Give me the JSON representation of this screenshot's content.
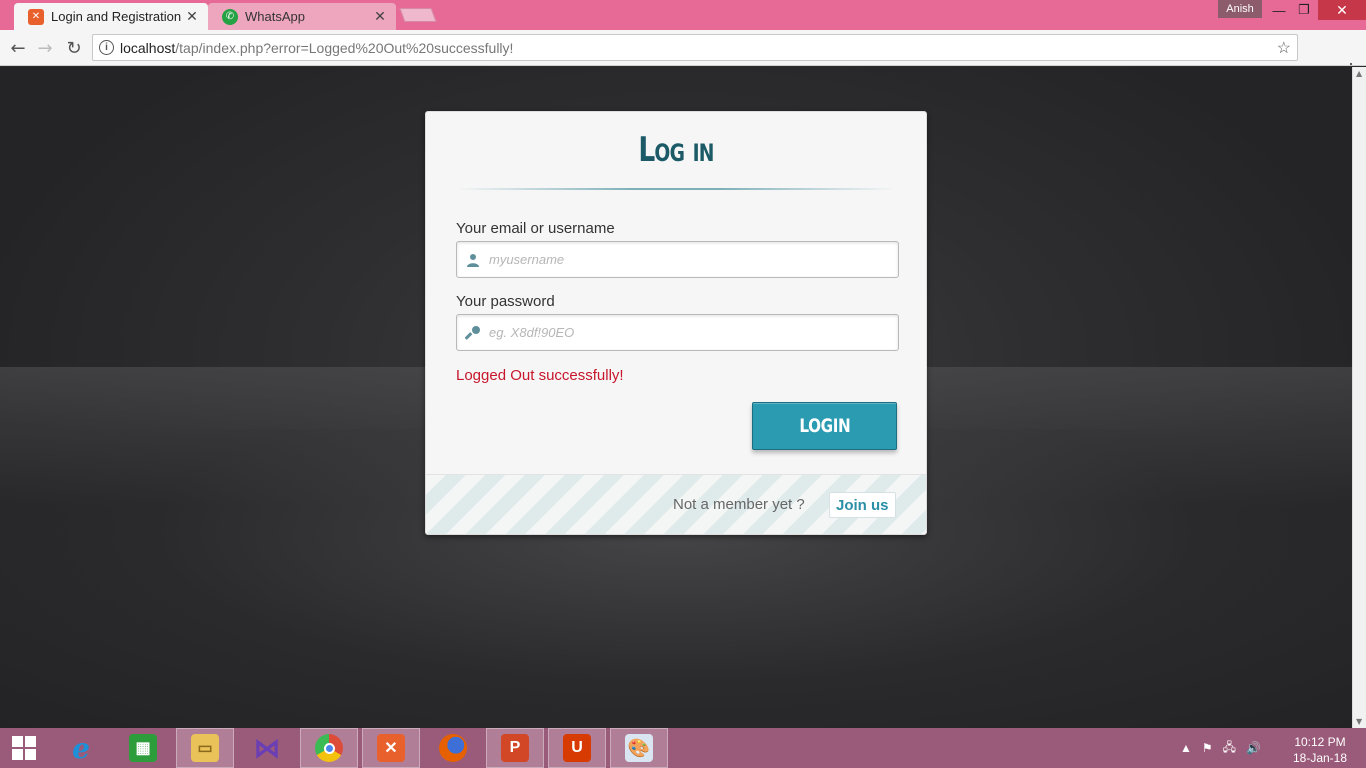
{
  "browser": {
    "tabs": [
      {
        "title": "Login and Registration",
        "active": true
      },
      {
        "title": "WhatsApp",
        "active": false
      }
    ],
    "profile": "Anish",
    "url_host": "localhost",
    "url_path": "/tap/index.php?error=Logged%20Out%20successfully!"
  },
  "login": {
    "title": "Log in",
    "email_label": "Your email or username",
    "email_placeholder": "myusername",
    "password_label": "Your password",
    "password_placeholder": "eg. X8df!90EO",
    "error_message": "Logged Out successfully!",
    "button_label": "LOGIN",
    "member_prompt": "Not a member yet ?",
    "join_label": "Join us"
  },
  "taskbar": {
    "apps": [
      {
        "name": "Internet Explorer",
        "icon": "ie-icon",
        "color": "#1e90d8"
      },
      {
        "name": "Store",
        "icon": "store-icon",
        "color": "#2d9c3b"
      },
      {
        "name": "File Explorer",
        "icon": "folder-icon",
        "color": "#e9c25a"
      },
      {
        "name": "Visual Studio",
        "icon": "vs-icon",
        "color": "#6a3fb5"
      },
      {
        "name": "Google Chrome",
        "icon": "chrome-icon",
        "color": "#dd4b39"
      },
      {
        "name": "XAMPP",
        "icon": "xampp-icon",
        "color": "#e8612c"
      },
      {
        "name": "Firefox",
        "icon": "firefox-icon",
        "color": "#e66000"
      },
      {
        "name": "PowerPoint",
        "icon": "powerpoint-icon",
        "color": "#d24726"
      },
      {
        "name": "Office",
        "icon": "office-icon",
        "color": "#d83b01"
      },
      {
        "name": "Paint",
        "icon": "paint-icon",
        "color": "#4a90c6"
      }
    ],
    "time": "10:12 PM",
    "date": "18-Jan-18"
  },
  "colors": {
    "accent": "#2b9bb1",
    "title": "#1c5a67",
    "error": "#c7162c",
    "tabstrip": "#e66a95",
    "taskbar": "#9a5a79"
  }
}
